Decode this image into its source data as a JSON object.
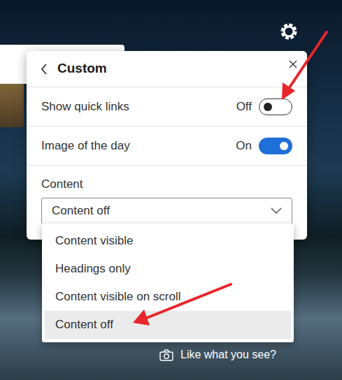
{
  "panel": {
    "title": "Custom"
  },
  "settings": [
    {
      "kind": "toggle",
      "label": "Show quick links",
      "state_text": "Off",
      "on": false
    },
    {
      "kind": "toggle",
      "label": "Image of the day",
      "state_text": "On",
      "on": true
    }
  ],
  "content": {
    "label": "Content",
    "value": "Content off",
    "expanded": true,
    "options": [
      {
        "label": "Content visible",
        "selected": false
      },
      {
        "label": "Headings only",
        "selected": false
      },
      {
        "label": "Content visible on scroll",
        "selected": false
      },
      {
        "label": "Content off",
        "selected": true
      }
    ]
  },
  "footer": {
    "text": "Like what you see?"
  }
}
